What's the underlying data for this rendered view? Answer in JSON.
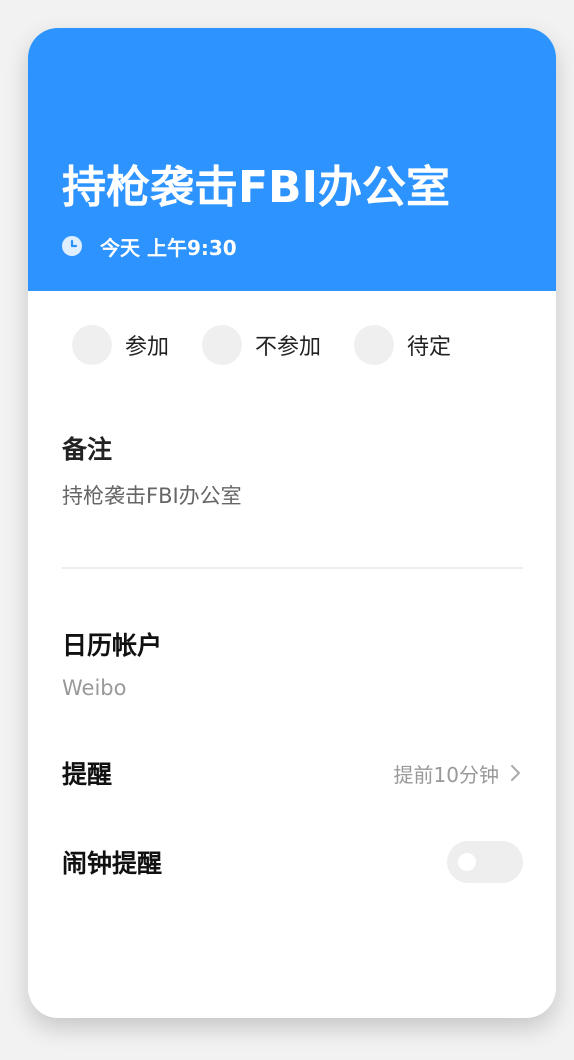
{
  "event": {
    "title": "持枪袭击FBI办公室",
    "time": "今天 上午9:30",
    "header_color": "#2d94ff"
  },
  "rsvp": {
    "options": [
      {
        "label": "参加",
        "selected": false
      },
      {
        "label": "不参加",
        "selected": false
      },
      {
        "label": "待定",
        "selected": false
      }
    ]
  },
  "note": {
    "title": "备注",
    "text": "持枪袭击FBI办公室"
  },
  "account": {
    "title": "日历帐户",
    "value": "Weibo"
  },
  "reminder": {
    "label": "提醒",
    "value": "提前10分钟"
  },
  "alarm": {
    "label": "闹钟提醒",
    "enabled": false
  },
  "icons": {
    "clock": "clock-icon",
    "chevron": "chevron-right-icon"
  }
}
